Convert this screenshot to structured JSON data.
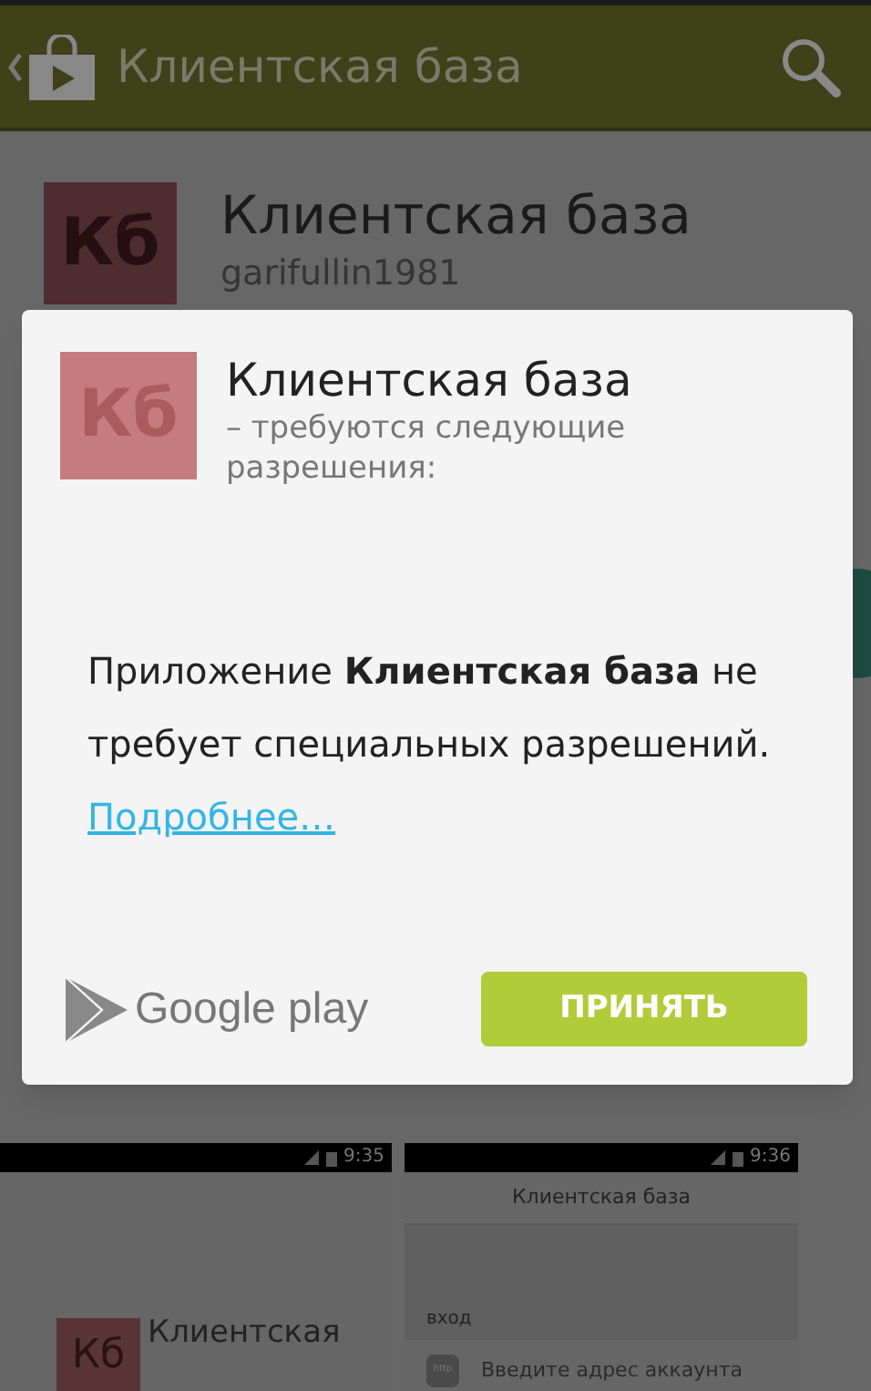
{
  "action_bar": {
    "title": "Клиентская база"
  },
  "app": {
    "icon_text": "Кб",
    "title": "Клиентская база",
    "developer": "garifullin1981"
  },
  "dialog": {
    "icon_text": "Кб",
    "title": "Клиентская база",
    "subtitle": "– требуются следующие разрешения:",
    "body": "Приложение **Клиентская база** не требует специальных разрешений.",
    "link": "Подробнее…",
    "brand": "Google play",
    "button": "ПРИНЯТЬ"
  },
  "screenshots": [
    {
      "kind": "detail",
      "time": "9:35",
      "icon_text": "Кб",
      "title": "Клиентская"
    },
    {
      "kind": "login",
      "time": "9:36",
      "title": "Клиентская база",
      "section": "вход",
      "field_icon": "http",
      "placeholder": "Введите адрес аккаунта"
    }
  ]
}
